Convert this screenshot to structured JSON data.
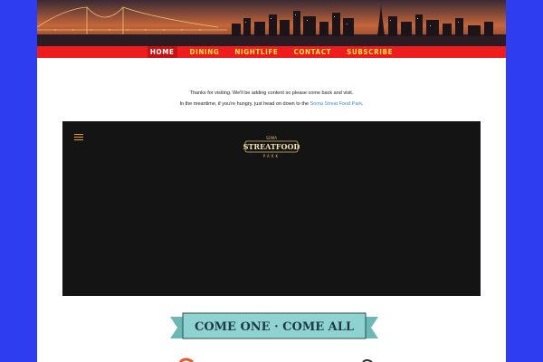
{
  "nav": {
    "items": [
      {
        "label": "HOME",
        "active": true
      },
      {
        "label": "DINING",
        "active": false
      },
      {
        "label": "NIGHTLIFE",
        "active": false
      },
      {
        "label": "CONTACT",
        "active": false
      },
      {
        "label": "SUBSCRIBE",
        "active": false
      }
    ]
  },
  "intro": {
    "line1": "Thanks for visiting.  We'll be adding content so please come back and visit.",
    "line2_prefix": "In the meantime, if you're hungry, just head on down to the",
    "line2_link": "Soma Streat Food Park",
    "line2_suffix": "."
  },
  "video": {
    "logo_title": "STREATFOOD",
    "logo_top": "SOMA",
    "logo_sub": "PARK"
  },
  "ribbon": {
    "text": "COME ONE · COME ALL"
  },
  "colors": {
    "page_background": "#2f3df0",
    "nav_background": "#ee1c1c",
    "nav_text": "#ffe04a",
    "link": "#3c8fd8",
    "video_background": "#141414",
    "ribbon": "#8fd3d1"
  }
}
